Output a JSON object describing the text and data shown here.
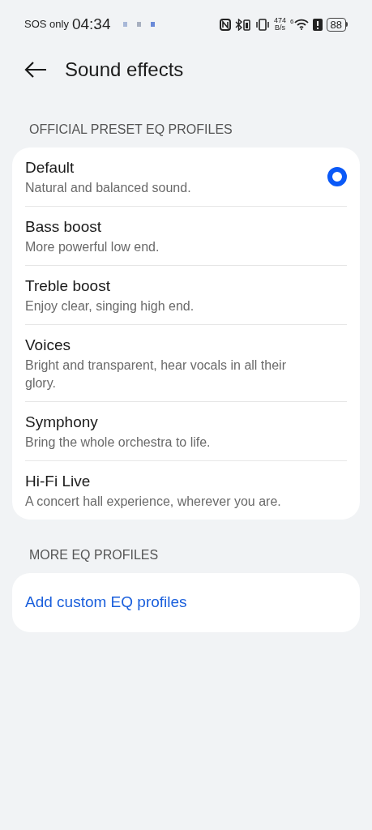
{
  "status_bar": {
    "carrier": "SOS only",
    "time": "04:34",
    "speed": "474",
    "speed_unit": "B/s",
    "wifi_generation": "6",
    "battery": "88"
  },
  "header": {
    "title": "Sound effects"
  },
  "sections": [
    {
      "title": "OFFICIAL PRESET EQ PROFILES",
      "kind": "radio",
      "items": [
        {
          "title": "Default",
          "subtitle": "Natural and balanced sound.",
          "selected": true
        },
        {
          "title": "Bass boost",
          "subtitle": "More powerful low end.",
          "selected": false
        },
        {
          "title": "Treble boost",
          "subtitle": "Enjoy clear, singing high end.",
          "selected": false
        },
        {
          "title": "Voices",
          "subtitle": "Bright and transparent, hear vocals in all their glory.",
          "selected": false
        },
        {
          "title": "Symphony",
          "subtitle": "Bring the whole orchestra to life.",
          "selected": false
        },
        {
          "title": "Hi-Fi Live",
          "subtitle": "A concert hall experience, wherever you are.",
          "selected": false
        }
      ]
    },
    {
      "title": "MORE EQ PROFILES",
      "kind": "link",
      "items": [
        {
          "title": "Add custom EQ profiles"
        }
      ]
    }
  ]
}
